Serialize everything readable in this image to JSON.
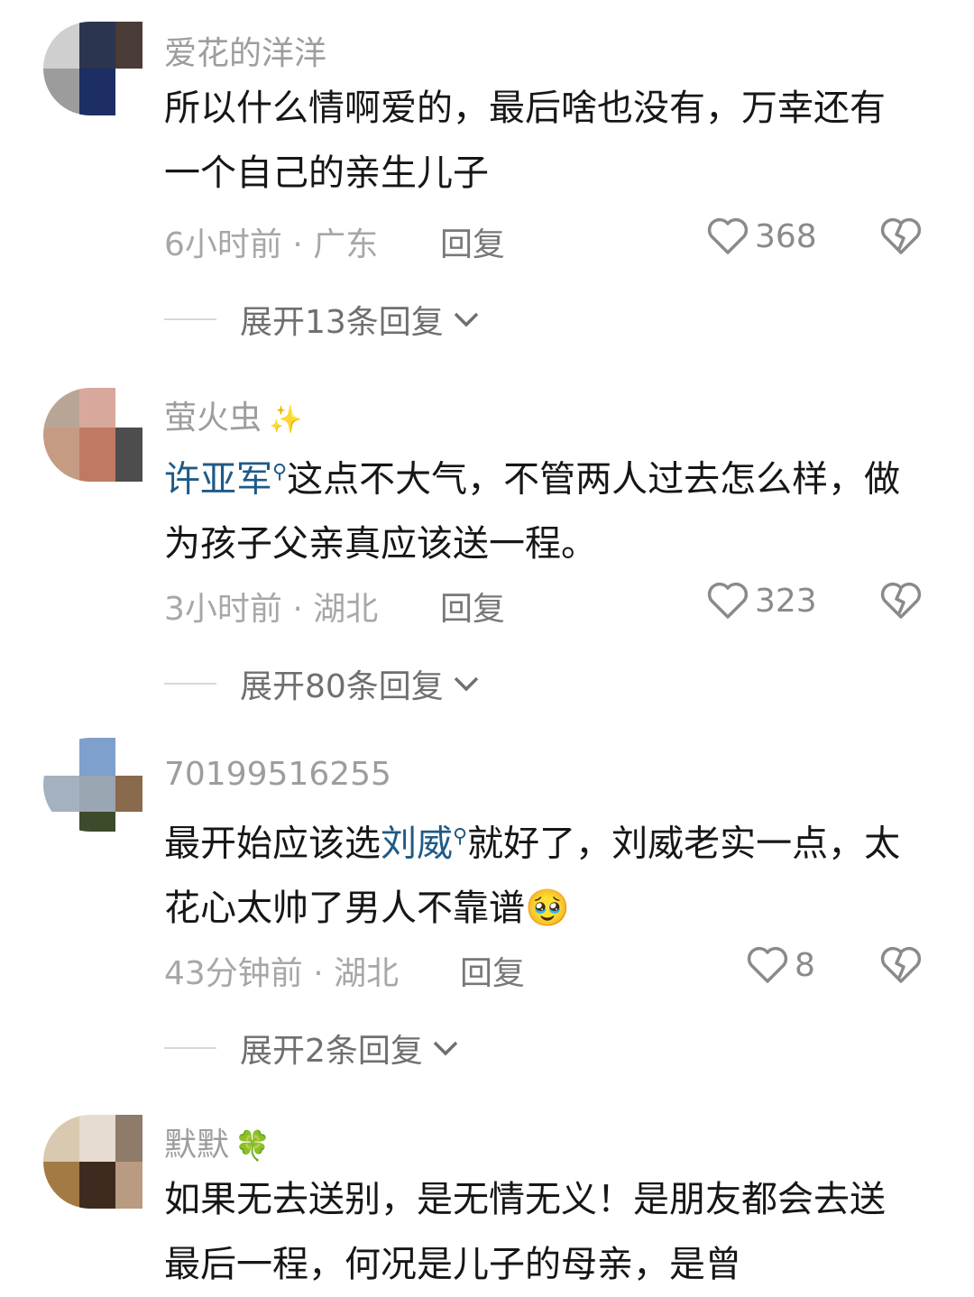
{
  "comments": [
    {
      "username": "爱花的洋洋",
      "username_decor": "",
      "text_before": "所以什么情啊爱的，最后啥也没有，万幸还有一个自己的亲生儿子",
      "mention": "",
      "text_after": "",
      "emoji": "",
      "time": "6小时前",
      "location": "广东",
      "reply_label": "回复",
      "likes": "368",
      "expand_label": "展开13条回复"
    },
    {
      "username": "萤火虫",
      "username_decor": "✨",
      "text_before": "",
      "mention": "许亚军",
      "text_after": "这点不大气，不管两人过去怎么样，做为孩子父亲真应该送一程。",
      "emoji": "",
      "time": "3小时前",
      "location": "湖北",
      "reply_label": "回复",
      "likes": "323",
      "expand_label": "展开80条回复"
    },
    {
      "username": "70199516255",
      "username_decor": "",
      "text_before": "最开始应该选",
      "mention": "刘威",
      "text_after": "就好了，刘威老实一点，太花心太帅了男人不靠谱",
      "emoji": "🥹",
      "time": "43分钟前",
      "location": "湖北",
      "reply_label": "回复",
      "likes": "8",
      "expand_label": "展开2条回复"
    },
    {
      "username": "默默",
      "username_decor": "🍀",
      "text_before": "如果无去送别，是无情无义！是朋友都会去送最后一程，何况是儿子的母亲，是曾",
      "mention": "",
      "text_after": "",
      "emoji": "",
      "time": "",
      "location": "",
      "reply_label": "",
      "likes": "",
      "expand_label": ""
    }
  ],
  "meta_separator": " · ",
  "icons": {
    "like": "heart-outline-icon",
    "dislike": "broken-heart-icon",
    "expand": "chevron-down-icon",
    "mention_search": "search-small-icon"
  },
  "colors": {
    "mention": "#1f5a87",
    "username": "#9d9d9d",
    "meta": "#a7a7a7"
  }
}
